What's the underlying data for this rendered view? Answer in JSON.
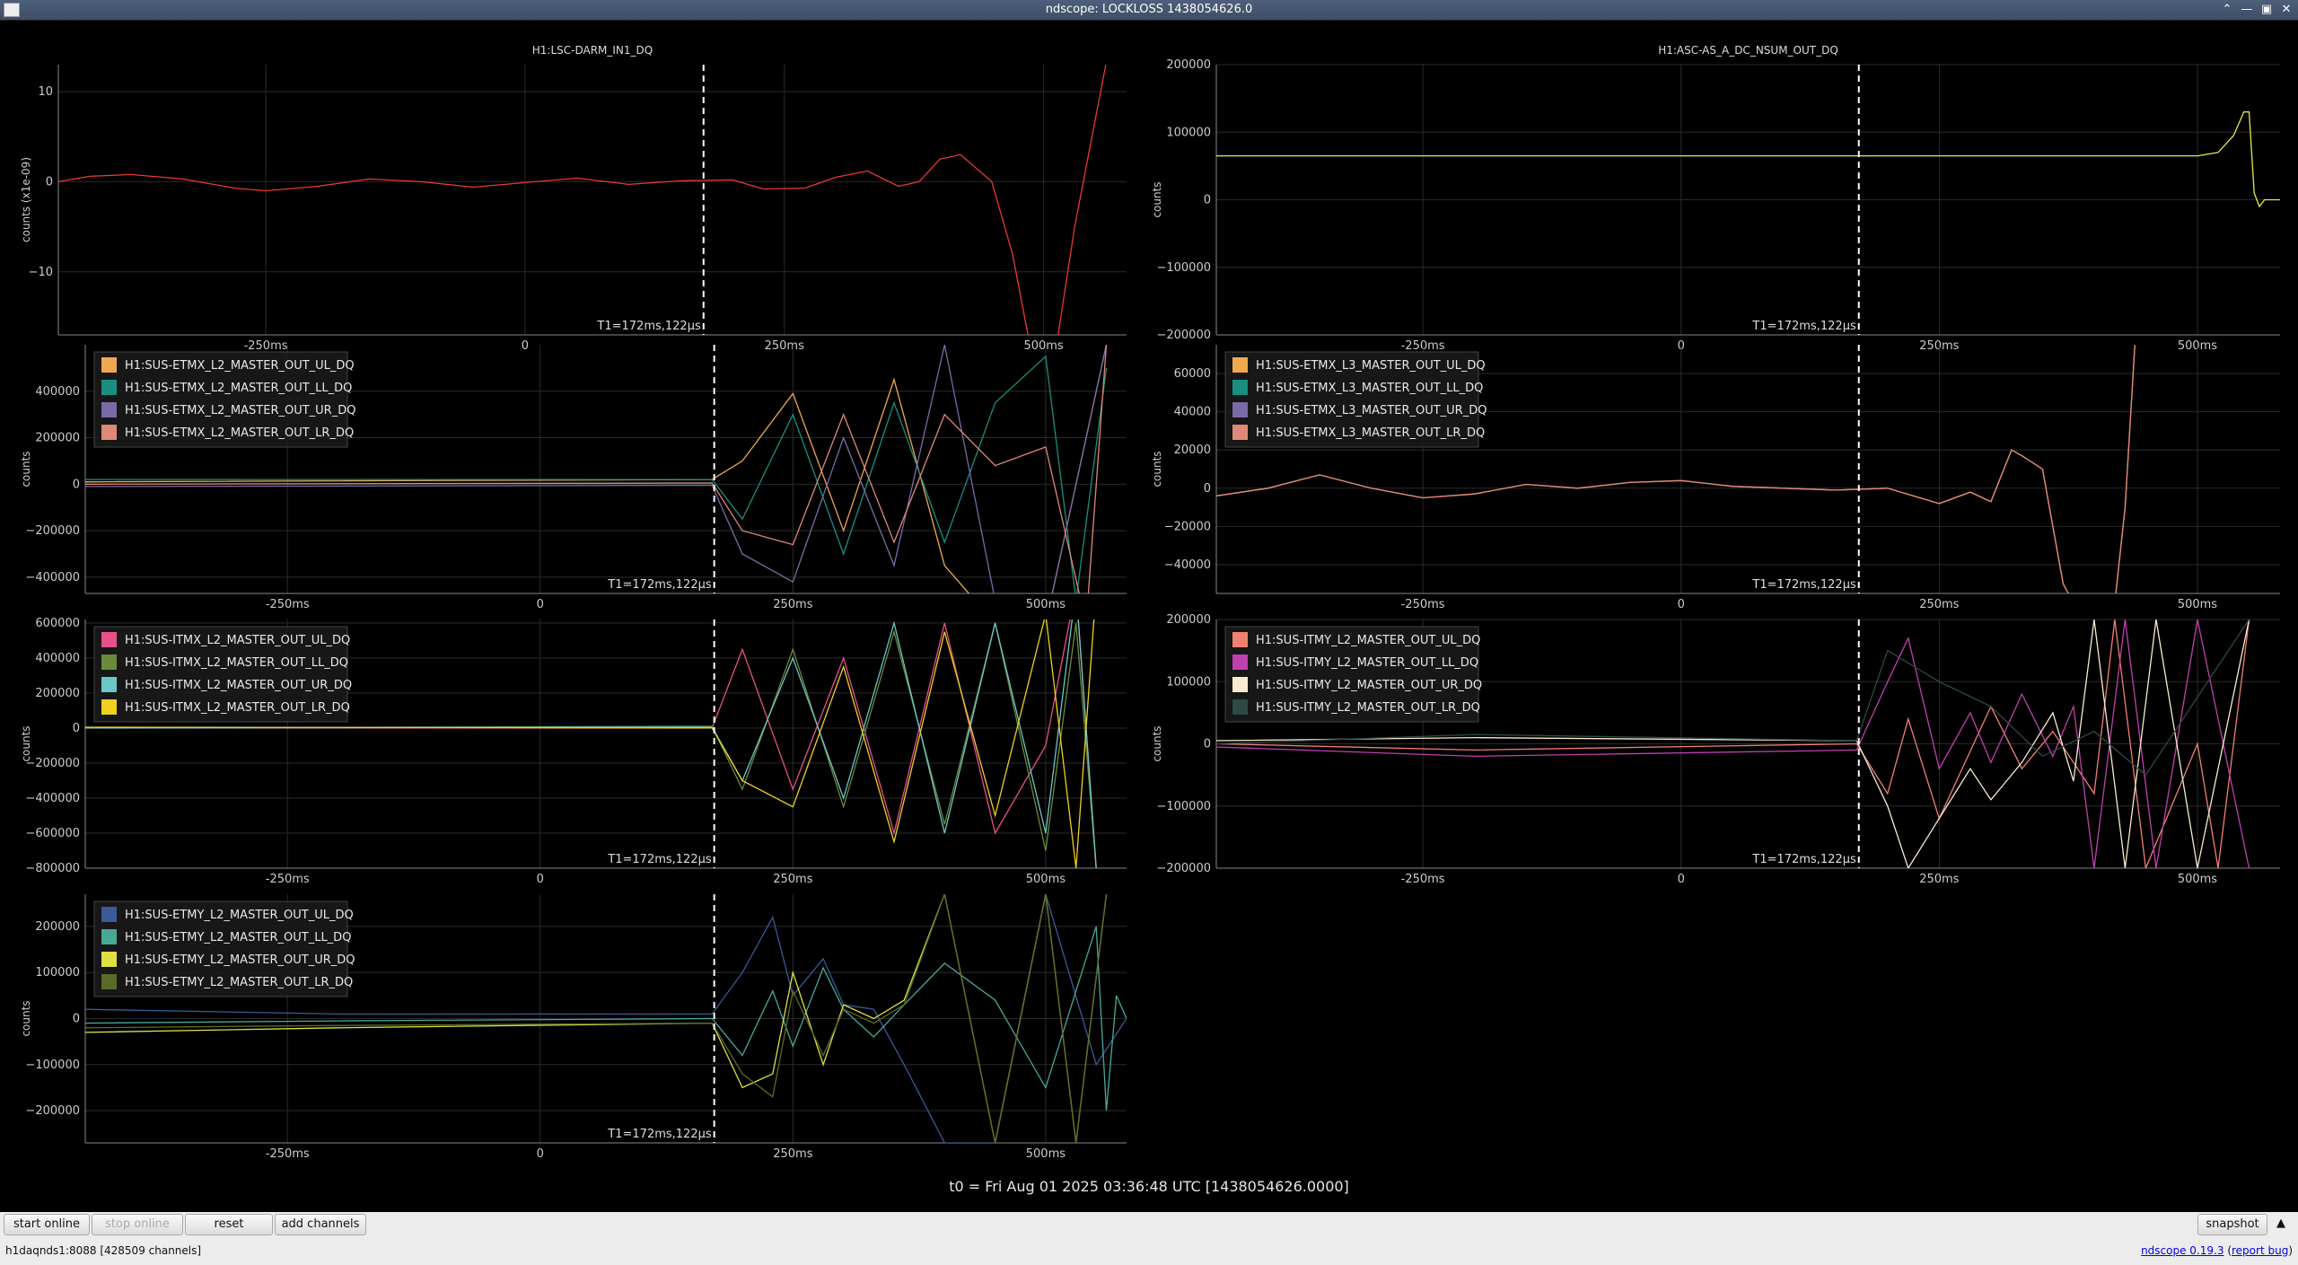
{
  "window": {
    "title": "ndscope: LOCKLOSS 1438054626.0"
  },
  "t0_label": "t0 = Fri Aug 01 2025 03:36:48 UTC [1438054626.0000]",
  "toolbar": {
    "start_online": "start online",
    "stop_online": "stop online",
    "reset": "reset",
    "add_channels": "add channels",
    "snapshot": "snapshot"
  },
  "status": {
    "server": "h1daqnds1:8088  [428509 channels]",
    "version_link": "ndscope 0.19.3",
    "report_bug_link": "report bug"
  },
  "chart_data": [
    {
      "type": "line",
      "title": "H1:LSC-DARM_IN1_DQ",
      "ylabel": "counts (x1e-09)",
      "xlim": [
        -0.45,
        0.58
      ],
      "ylim": [
        -17,
        13
      ],
      "yticks": [
        -10,
        0,
        10
      ],
      "xticks": [
        -0.25,
        0,
        0.25,
        0.5
      ],
      "xticklabels": [
        "-250ms",
        "0",
        "250ms",
        "500ms"
      ],
      "cursor": {
        "x": 0.172122,
        "label": "T1=172ms,122µs"
      },
      "legend": false,
      "series": [
        {
          "color": "#e83a2f",
          "x": [
            -0.45,
            -0.42,
            -0.38,
            -0.33,
            -0.28,
            -0.25,
            -0.2,
            -0.15,
            -0.1,
            -0.05,
            0,
            0.05,
            0.1,
            0.15,
            0.2,
            0.23,
            0.27,
            0.3,
            0.33,
            0.36,
            0.38,
            0.4,
            0.42,
            0.45,
            0.47,
            0.49,
            0.51,
            0.53,
            0.56
          ],
          "y": [
            0,
            0.6,
            0.8,
            0.3,
            -0.7,
            -1,
            -0.5,
            0.3,
            0,
            -0.6,
            -0.1,
            0.4,
            -0.3,
            0.1,
            0.2,
            -0.8,
            -0.7,
            0.5,
            1.2,
            -0.5,
            0,
            2.5,
            3,
            0,
            -8,
            -20,
            -20,
            -5,
            13
          ]
        }
      ]
    },
    {
      "type": "line",
      "title": "H1:ASC-AS_A_DC_NSUM_OUT_DQ",
      "ylabel": "counts",
      "xlim": [
        -0.45,
        0.58
      ],
      "ylim": [
        -200000,
        200000
      ],
      "yticks": [
        -200000,
        -100000,
        0,
        100000,
        200000
      ],
      "xticks": [
        -0.25,
        0,
        0.25,
        0.5
      ],
      "xticklabels": [
        "-250ms",
        "0",
        "250ms",
        "500ms"
      ],
      "cursor": {
        "x": 0.172122,
        "label": "T1=172ms,122µs"
      },
      "legend": false,
      "series": [
        {
          "color": "#e8e84a",
          "x": [
            -0.45,
            0.4,
            0.5,
            0.52,
            0.535,
            0.545,
            0.55,
            0.555,
            0.56,
            0.565,
            0.58
          ],
          "y": [
            65000,
            65000,
            65000,
            70000,
            95000,
            130000,
            130000,
            10000,
            -10000,
            0,
            0
          ]
        }
      ]
    },
    {
      "type": "line",
      "ylabel": "counts",
      "xlim": [
        -0.45,
        0.58
      ],
      "ylim": [
        -470000,
        600000
      ],
      "yticks": [
        -400000,
        -200000,
        0,
        200000,
        400000
      ],
      "xticks": [
        -0.25,
        0,
        0.25,
        0.5
      ],
      "xticklabels": [
        "-250ms",
        "0",
        "250ms",
        "500ms"
      ],
      "cursor": {
        "x": 0.172122,
        "label": "T1=172ms,122µs"
      },
      "legend": true,
      "series": [
        {
          "name": "H1:SUS-ETMX_L2_MASTER_OUT_UL_DQ",
          "color": "#f0a850",
          "x": [
            -0.45,
            0.17,
            0.2,
            0.25,
            0.3,
            0.35,
            0.4,
            0.45,
            0.5,
            0.54,
            0.56
          ],
          "y": [
            10000,
            20000,
            100000,
            390000,
            -200000,
            450000,
            -350000,
            -600000,
            -600000,
            200000,
            600000
          ]
        },
        {
          "name": "H1:SUS-ETMX_L2_MASTER_OUT_LL_DQ",
          "color": "#1a8f7f",
          "x": [
            -0.45,
            0.17,
            0.2,
            0.25,
            0.3,
            0.35,
            0.4,
            0.45,
            0.5,
            0.53,
            0.56
          ],
          "y": [
            20000,
            20000,
            -150000,
            300000,
            -300000,
            350000,
            -250000,
            350000,
            550000,
            -500000,
            500000
          ]
        },
        {
          "name": "H1:SUS-ETMX_L2_MASTER_OUT_UR_DQ",
          "color": "#7a6aa8",
          "x": [
            -0.45,
            0.17,
            0.2,
            0.25,
            0.3,
            0.35,
            0.4,
            0.45,
            0.5,
            0.56
          ],
          "y": [
            -10000,
            -5000,
            -300000,
            -420000,
            200000,
            -350000,
            600000,
            -500000,
            -600000,
            600000
          ]
        },
        {
          "name": "H1:SUS-ETMX_L2_MASTER_OUT_LR_DQ",
          "color": "#e08878",
          "x": [
            -0.45,
            0.17,
            0.2,
            0.25,
            0.3,
            0.35,
            0.4,
            0.45,
            0.5,
            0.54,
            0.56
          ],
          "y": [
            0,
            5000,
            -200000,
            -260000,
            300000,
            -250000,
            300000,
            80000,
            160000,
            -600000,
            600000
          ]
        }
      ]
    },
    {
      "type": "line",
      "ylabel": "counts",
      "xlim": [
        -0.45,
        0.58
      ],
      "ylim": [
        -55000,
        75000
      ],
      "yticks": [
        -40000,
        -20000,
        0,
        20000,
        40000,
        60000
      ],
      "xticks": [
        -0.25,
        0,
        0.25,
        0.5
      ],
      "xticklabels": [
        "-250ms",
        "0",
        "250ms",
        "500ms"
      ],
      "cursor": {
        "x": 0.172122,
        "label": "T1=172ms,122µs"
      },
      "legend": true,
      "series": [
        {
          "name": "H1:SUS-ETMX_L3_MASTER_OUT_UL_DQ",
          "color": "#f0a850",
          "x": [
            -0.45,
            -0.4,
            -0.35,
            -0.3,
            -0.25,
            -0.2,
            -0.15,
            -0.1,
            -0.05,
            0,
            0.05,
            0.1,
            0.15,
            0.2,
            0.25,
            0.28,
            0.3,
            0.32,
            0.33,
            0.35,
            0.37,
            0.38,
            0.39,
            0.4,
            0.42,
            0.43,
            0.44
          ],
          "y": [
            -4000,
            0,
            7000,
            0,
            -5000,
            -3000,
            2000,
            0,
            3000,
            4000,
            1000,
            0,
            -1000,
            0,
            -8000,
            -2000,
            -7000,
            20000,
            17000,
            10000,
            -50000,
            -60000,
            -60000,
            -60000,
            -60000,
            -10000,
            80000
          ]
        },
        {
          "name": "H1:SUS-ETMX_L3_MASTER_OUT_LL_DQ",
          "color": "#1a8f7f",
          "hidden_under_others": true,
          "x": [],
          "y": []
        },
        {
          "name": "H1:SUS-ETMX_L3_MASTER_OUT_UR_DQ",
          "color": "#7a6aa8",
          "hidden_under_others": true,
          "x": [],
          "y": []
        },
        {
          "name": "H1:SUS-ETMX_L3_MASTER_OUT_LR_DQ",
          "color": "#e08878",
          "x": [
            -0.45,
            -0.4,
            -0.35,
            -0.3,
            -0.25,
            -0.2,
            -0.15,
            -0.1,
            -0.05,
            0,
            0.05,
            0.1,
            0.15,
            0.2,
            0.25,
            0.28,
            0.3,
            0.32,
            0.33,
            0.35,
            0.37,
            0.38,
            0.39,
            0.4,
            0.42,
            0.43,
            0.44
          ],
          "y": [
            -4000,
            0,
            7000,
            0,
            -5000,
            -3000,
            2000,
            0,
            3000,
            4000,
            1000,
            0,
            -1000,
            0,
            -8000,
            -2000,
            -7000,
            20000,
            17000,
            10000,
            -50000,
            -60000,
            -60000,
            -60000,
            -60000,
            -10000,
            80000
          ]
        }
      ]
    },
    {
      "type": "line",
      "ylabel": "counts",
      "xlim": [
        -0.45,
        0.58
      ],
      "ylim": [
        -800000,
        620000
      ],
      "yticks": [
        -800000,
        -600000,
        -400000,
        -200000,
        0,
        200000,
        400000,
        600000
      ],
      "xticks": [
        -0.25,
        0,
        0.25,
        0.5
      ],
      "xticklabels": [
        "-250ms",
        "0",
        "250ms",
        "500ms"
      ],
      "cursor": {
        "x": 0.172122,
        "label": "T1=172ms,122µs"
      },
      "legend": true,
      "series": [
        {
          "name": "H1:SUS-ITMX_L2_MASTER_OUT_UL_DQ",
          "color": "#e8508a",
          "x": [
            -0.45,
            0.17,
            0.2,
            0.25,
            0.3,
            0.35,
            0.4,
            0.45,
            0.5,
            0.53,
            0.55
          ],
          "y": [
            0,
            0,
            450000,
            -350000,
            400000,
            -600000,
            600000,
            -600000,
            -100000,
            800000,
            -800000
          ]
        },
        {
          "name": "H1:SUS-ITMX_L2_MASTER_OUT_LL_DQ",
          "color": "#6a8a3a",
          "x": [
            -0.45,
            0.17,
            0.2,
            0.25,
            0.3,
            0.35,
            0.4,
            0.45,
            0.5,
            0.53,
            0.55
          ],
          "y": [
            0,
            10000,
            -350000,
            450000,
            -450000,
            550000,
            -550000,
            600000,
            -700000,
            600000,
            -800000
          ]
        },
        {
          "name": "H1:SUS-ITMX_L2_MASTER_OUT_UR_DQ",
          "color": "#6ac8c8",
          "x": [
            -0.45,
            0.17,
            0.2,
            0.25,
            0.3,
            0.35,
            0.4,
            0.45,
            0.5,
            0.53,
            0.55
          ],
          "y": [
            0,
            5000,
            -300000,
            400000,
            -400000,
            600000,
            -600000,
            600000,
            -600000,
            800000,
            -800000
          ]
        },
        {
          "name": "H1:SUS-ITMX_L2_MASTER_OUT_LR_DQ",
          "color": "#f0d020",
          "x": [
            -0.45,
            0.17,
            0.2,
            0.25,
            0.3,
            0.35,
            0.4,
            0.45,
            0.5,
            0.53,
            0.55
          ],
          "y": [
            5000,
            0,
            -300000,
            -450000,
            350000,
            -650000,
            550000,
            -500000,
            650000,
            -800000,
            800000
          ]
        }
      ]
    },
    {
      "type": "line",
      "ylabel": "counts",
      "xlim": [
        -0.45,
        0.58
      ],
      "ylim": [
        -200000,
        200000
      ],
      "yticks": [
        -200000,
        -100000,
        0,
        100000,
        200000
      ],
      "xticks": [
        -0.25,
        0,
        0.25,
        0.5
      ],
      "xticklabels": [
        "-250ms",
        "0",
        "250ms",
        "500ms"
      ],
      "cursor": {
        "x": 0.172122,
        "label": "T1=172ms,122µs"
      },
      "legend": true,
      "series": [
        {
          "name": "H1:SUS-ITMY_L2_MASTER_OUT_UL_DQ",
          "color": "#f08070",
          "x": [
            -0.45,
            -0.2,
            0.17,
            0.2,
            0.22,
            0.25,
            0.3,
            0.33,
            0.36,
            0.4,
            0.42,
            0.45,
            0.5,
            0.52,
            0.55
          ],
          "y": [
            0,
            -10000,
            0,
            -80000,
            40000,
            -120000,
            60000,
            -40000,
            20000,
            -80000,
            200000,
            -200000,
            0,
            -200000,
            200000
          ]
        },
        {
          "name": "H1:SUS-ITMY_L2_MASTER_OUT_LL_DQ",
          "color": "#c040b0",
          "x": [
            -0.45,
            -0.2,
            0.17,
            0.2,
            0.22,
            0.25,
            0.28,
            0.3,
            0.33,
            0.36,
            0.38,
            0.4,
            0.43,
            0.46,
            0.5,
            0.55
          ],
          "y": [
            -5000,
            -20000,
            -10000,
            100000,
            170000,
            -40000,
            50000,
            -30000,
            80000,
            -20000,
            60000,
            -200000,
            200000,
            -200000,
            200000,
            -200000
          ]
        },
        {
          "name": "H1:SUS-ITMY_L2_MASTER_OUT_UR_DQ",
          "color": "#f8ecd0",
          "x": [
            -0.45,
            -0.2,
            0.17,
            0.2,
            0.22,
            0.25,
            0.28,
            0.3,
            0.33,
            0.36,
            0.38,
            0.4,
            0.43,
            0.46,
            0.5,
            0.55
          ],
          "y": [
            5000,
            10000,
            5000,
            -100000,
            -200000,
            -120000,
            -40000,
            -90000,
            -30000,
            50000,
            -60000,
            200000,
            -200000,
            200000,
            -200000,
            200000
          ]
        },
        {
          "name": "H1:SUS-ITMY_L2_MASTER_OUT_LR_DQ",
          "color": "#2f4a44",
          "x": [
            -0.45,
            -0.2,
            0.17,
            0.2,
            0.25,
            0.3,
            0.35,
            0.4,
            0.45,
            0.55
          ],
          "y": [
            0,
            15000,
            5000,
            150000,
            100000,
            60000,
            -20000,
            20000,
            -50000,
            200000
          ]
        }
      ]
    },
    {
      "type": "line",
      "ylabel": "counts",
      "xlim": [
        -0.45,
        0.58
      ],
      "ylim": [
        -270000,
        270000
      ],
      "yticks": [
        -200000,
        -100000,
        0,
        100000,
        200000
      ],
      "xticks": [
        -0.25,
        0,
        0.25,
        0.5
      ],
      "xticklabels": [
        "-250ms",
        "0",
        "250ms",
        "500ms"
      ],
      "cursor": {
        "x": 0.172122,
        "label": "T1=172ms,122µs"
      },
      "legend": true,
      "series": [
        {
          "name": "H1:SUS-ETMY_L2_MASTER_OUT_UL_DQ",
          "color": "#3a5a9a",
          "x": [
            -0.45,
            -0.2,
            0.17,
            0.2,
            0.23,
            0.25,
            0.28,
            0.3,
            0.33,
            0.36,
            0.4,
            0.45,
            0.5,
            0.55,
            0.58
          ],
          "y": [
            20000,
            10000,
            10000,
            100000,
            220000,
            50000,
            130000,
            30000,
            20000,
            -100000,
            -270000,
            -270000,
            270000,
            -100000,
            0
          ]
        },
        {
          "name": "H1:SUS-ETMY_L2_MASTER_OUT_LL_DQ",
          "color": "#48a898",
          "x": [
            -0.45,
            -0.2,
            0.17,
            0.2,
            0.23,
            0.25,
            0.28,
            0.3,
            0.33,
            0.36,
            0.4,
            0.45,
            0.5,
            0.55,
            0.56,
            0.57,
            0.58
          ],
          "y": [
            -10000,
            -5000,
            0,
            -80000,
            60000,
            -60000,
            110000,
            20000,
            -40000,
            30000,
            120000,
            40000,
            -150000,
            200000,
            -200000,
            50000,
            0
          ]
        },
        {
          "name": "H1:SUS-ETMY_L2_MASTER_OUT_UR_DQ",
          "color": "#e0e040",
          "x": [
            -0.45,
            -0.2,
            0.17,
            0.2,
            0.23,
            0.25,
            0.28,
            0.3,
            0.33,
            0.36,
            0.4,
            0.45,
            0.5,
            0.53,
            0.56
          ],
          "y": [
            -30000,
            -20000,
            -10000,
            -150000,
            -120000,
            100000,
            -100000,
            30000,
            0,
            40000,
            270000,
            -270000,
            270000,
            -270000,
            270000
          ]
        },
        {
          "name": "H1:SUS-ETMY_L2_MASTER_OUT_LR_DQ",
          "color": "#5a6a2a",
          "x": [
            -0.45,
            -0.2,
            0.17,
            0.2,
            0.23,
            0.25,
            0.28,
            0.3,
            0.33,
            0.36,
            0.4,
            0.45,
            0.5,
            0.53,
            0.56
          ],
          "y": [
            -20000,
            -15000,
            -10000,
            -120000,
            -170000,
            60000,
            -80000,
            20000,
            -10000,
            30000,
            270000,
            -270000,
            270000,
            -270000,
            270000
          ]
        }
      ]
    }
  ]
}
